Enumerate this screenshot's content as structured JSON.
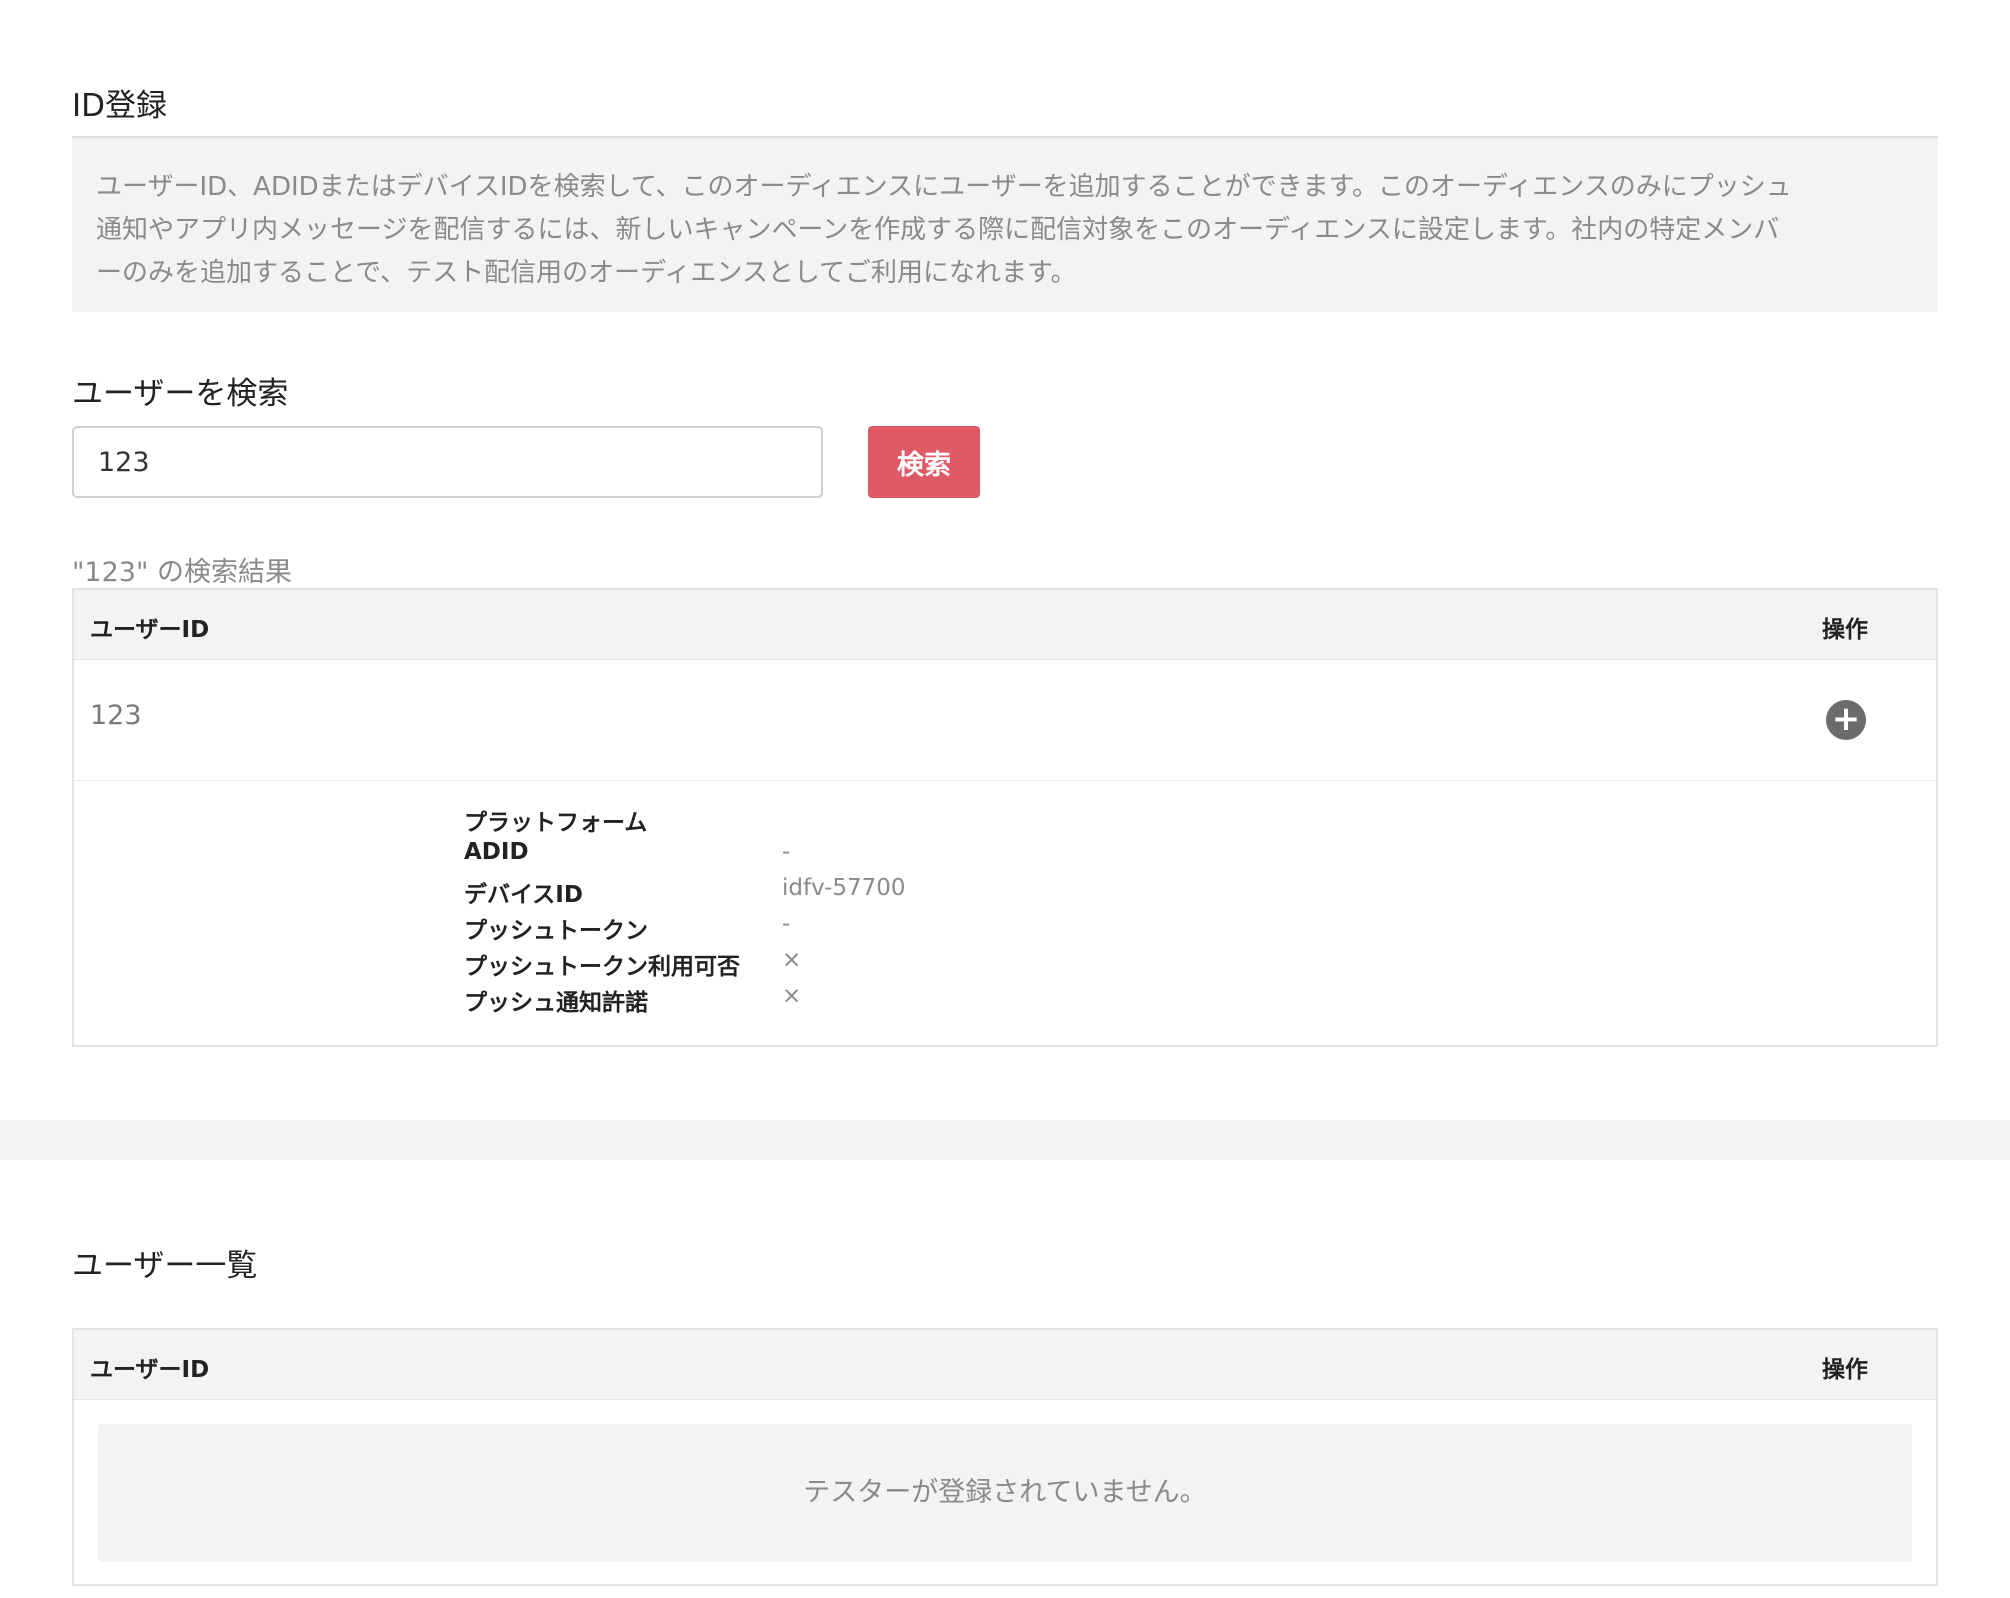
{
  "registration": {
    "title": "ID登録",
    "description_lines": [
      "ユーザーID、ADIDまたはデバイスIDを検索して、このオーディエンスにユーザーを追加することができます。このオーディエンスのみにプッシュ",
      "通知やアプリ内メッセージを配信するには、新しいキャンペーンを作成する際に配信対象をこのオーディエンスに設定します。社内の特定メンバ",
      "ーのみを追加することで、テスト配信用のオーディエンスとしてご利用になれます。"
    ]
  },
  "search": {
    "title": "ユーザーを検索",
    "input_value": "123",
    "button_label": "検索",
    "result_caption": "\"123\" の検索結果"
  },
  "results_table": {
    "col_user_id": "ユーザーID",
    "col_action": "操作",
    "rows": [
      {
        "user_id": "123",
        "add_icon": "plus-circle-icon",
        "details": [
          {
            "key": "プラットフォーム",
            "value": ""
          },
          {
            "key": "ADID",
            "value": "-"
          },
          {
            "key": "デバイスID",
            "value": "idfv-57700"
          },
          {
            "key": "プッシュトークン",
            "value": "-"
          },
          {
            "key": "プッシュトークン利用可否",
            "value": "×"
          },
          {
            "key": "プッシュ通知許諾",
            "value": "×"
          }
        ]
      }
    ]
  },
  "user_list": {
    "title": "ユーザー一覧",
    "col_user_id": "ユーザーID",
    "col_action": "操作",
    "empty_message": "テスターが登録されていません。"
  },
  "colors": {
    "accent": "#e05a66",
    "panel_bg": "#f3f3f3",
    "muted_text": "#8a8a8a"
  }
}
